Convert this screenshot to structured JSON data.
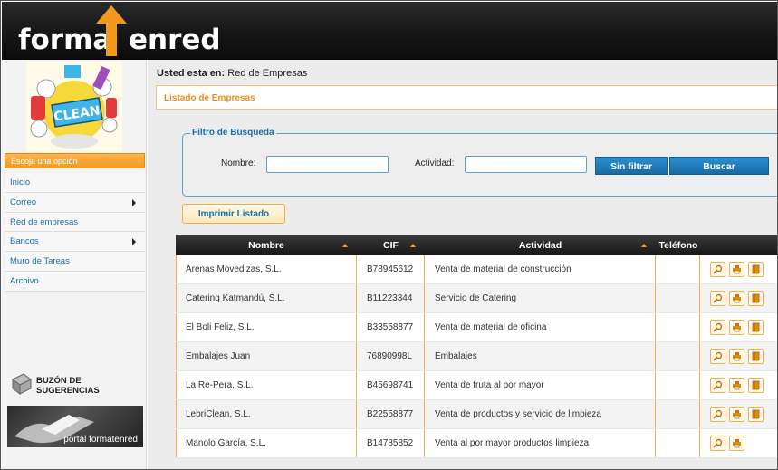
{
  "header": {
    "logo_part1": "forma",
    "logo_part2": "enred"
  },
  "sidebar": {
    "choose_option": "Escoja una opción",
    "mascot_text": "CLEAN",
    "menu": [
      {
        "label": "Inicio",
        "has_arrow": false
      },
      {
        "label": "Correo",
        "has_arrow": true
      },
      {
        "label": "Red de empresas",
        "has_arrow": false
      },
      {
        "label": "Bancos",
        "has_arrow": true
      },
      {
        "label": "Muro de Tareas",
        "has_arrow": false
      },
      {
        "label": "Archivo",
        "has_arrow": false
      }
    ],
    "suggestions_line1": "BUZÓN DE",
    "suggestions_line2": "SUGERENCIAS",
    "portal_label": "portal formatenred"
  },
  "breadcrumb": {
    "prefix": "Usted esta en:",
    "location": "Red de Empresas"
  },
  "panel": {
    "title": "Listado de Empresas"
  },
  "filter": {
    "legend": "Filtro de Busqueda",
    "name_label": "Nombre:",
    "name_value": "",
    "activity_label": "Actividad:",
    "activity_value": "",
    "no_filter_label": "Sin filtrar",
    "search_label": "Buscar"
  },
  "print_label": "Imprimir Listado",
  "table": {
    "columns": [
      "Nombre",
      "CIF",
      "Actividad",
      "Teléfono"
    ],
    "rows": [
      {
        "nombre": "Arenas Movedizas, S.L.",
        "cif": "B78945612",
        "actividad": "Venta de material de construcción",
        "telefono": "",
        "actions": 3
      },
      {
        "nombre": "Catering Katmandú, S.L.",
        "cif": "B11223344",
        "actividad": "Servicio de Catering",
        "telefono": "",
        "actions": 3
      },
      {
        "nombre": "El Boli Feliz, S.L.",
        "cif": "B33558877",
        "actividad": "Venta de material de oficina",
        "telefono": "",
        "actions": 3
      },
      {
        "nombre": "Embalajes Juan",
        "cif": "76890998L",
        "actividad": "Embalajes",
        "telefono": "",
        "actions": 3
      },
      {
        "nombre": "La Re-Pera, S.L.",
        "cif": "B45698741",
        "actividad": "Venta de fruta al por mayor",
        "telefono": "",
        "actions": 3
      },
      {
        "nombre": "LebriClean, S.L.",
        "cif": "B22558877",
        "actividad": "Venta de productos y servicio de limpieza",
        "telefono": "",
        "actions": 3
      },
      {
        "nombre": "Manolo García, S.L.",
        "cif": "B14785852",
        "actividad": "Venta al por mayor productos limpieza",
        "telefono": "",
        "actions": 2
      }
    ]
  },
  "icons": {
    "view": "magnifier-icon",
    "print": "printer-icon",
    "book": "book-icon"
  },
  "colors": {
    "accent_orange": "#f39a1e",
    "link_blue": "#1a6fa6",
    "button_blue": "#1f7bbd"
  }
}
